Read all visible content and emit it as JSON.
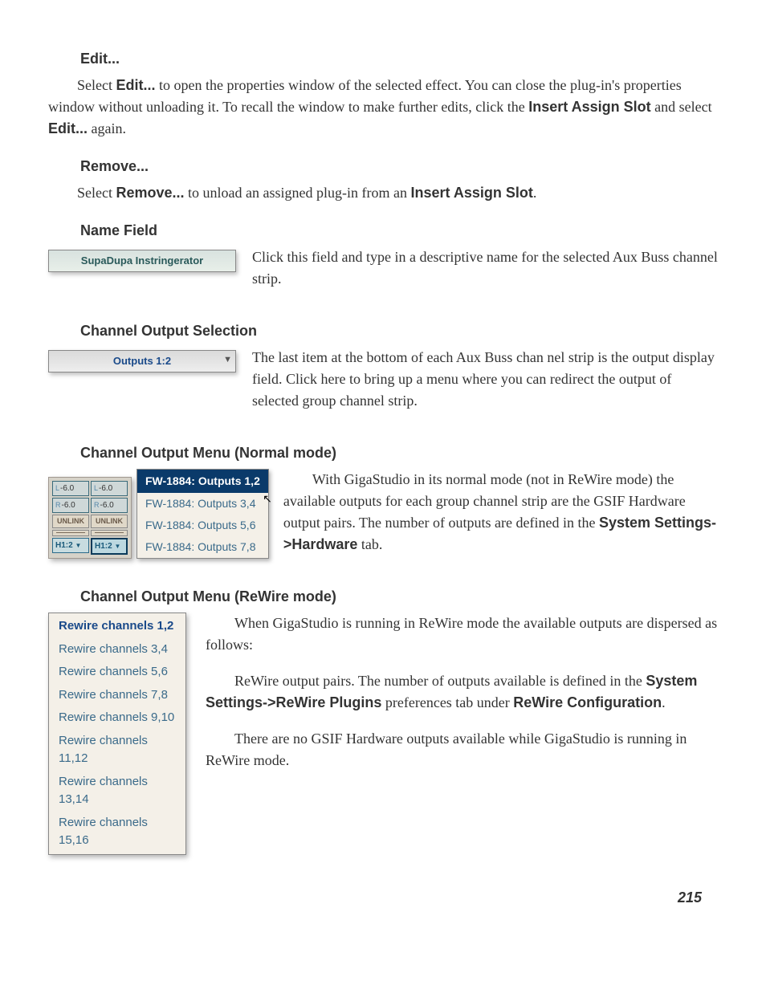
{
  "sections": {
    "edit": {
      "heading": "Edit...",
      "p1_a": "Select ",
      "p1_b": "Edit...",
      "p1_c": " to open the properties window of the selected effect. You can close the plug-in's properties window without unloading it. To recall the window to make further edits, click the ",
      "p1_d": "Insert Assign Slot",
      "p1_e": " and select ",
      "p1_f": "Edit...",
      "p1_g": " again."
    },
    "remove": {
      "heading": "Remove...",
      "p1_a": "Select ",
      "p1_b": "Remove...",
      "p1_c": " to unload an assigned plug-in from an ",
      "p1_d": "Insert Assign Slot",
      "p1_e": "."
    },
    "name_field": {
      "heading": "Name Field",
      "field_value": "SupaDupa Instringerator",
      "p1": "Click this field and type in a descriptive name for the selected Aux Buss channel strip."
    },
    "output_sel": {
      "heading": "Channel Output Selection",
      "field_value": "Outputs 1:2",
      "p1": "The last item at the bottom of each Aux Buss chan nel strip is the output display field. Click here to bring up a menu where you can redirect the output of selected group channel strip."
    },
    "output_menu_normal": {
      "heading": "Channel Output Menu (Normal mode)",
      "strip": {
        "l_val": "-6.0",
        "r_val": "-6.0",
        "unlink": "UNLINK",
        "h_sel": "H1:2"
      },
      "menu": [
        "FW-1884: Outputs 1,2",
        "FW-1884: Outputs 3,4",
        "FW-1884: Outputs 5,6",
        "FW-1884: Outputs 7,8"
      ],
      "p1_a": "With GigaStudio in its normal mode (not in ReWire mode) the available outputs for each group channel strip are the GSIF Hardware output pairs. The number of outputs are defined in the ",
      "p1_b": "System Settings->Hardware",
      "p1_c": " tab."
    },
    "output_menu_rewire": {
      "heading": "Channel Output Menu (ReWire mode)",
      "menu": [
        "Rewire channels 1,2",
        "Rewire channels 3,4",
        "Rewire channels 5,6",
        "Rewire channels 7,8",
        "Rewire channels 9,10",
        "Rewire channels 11,12",
        "Rewire channels 13,14",
        "Rewire channels 15,16"
      ],
      "p1": "When GigaStudio is running in ReWire mode the available outputs are dispersed as follows:",
      "p2_a": "ReWire output pairs. The number of outputs available is defined in the ",
      "p2_b": "System Settings->ReWire Plugins",
      "p2_c": " preferences tab under ",
      "p2_d": "ReWire Configuration",
      "p2_e": ".",
      "p3": "There are no GSIF Hardware outputs available while GigaStudio is running in ReWire mode."
    }
  },
  "page_number": "215"
}
